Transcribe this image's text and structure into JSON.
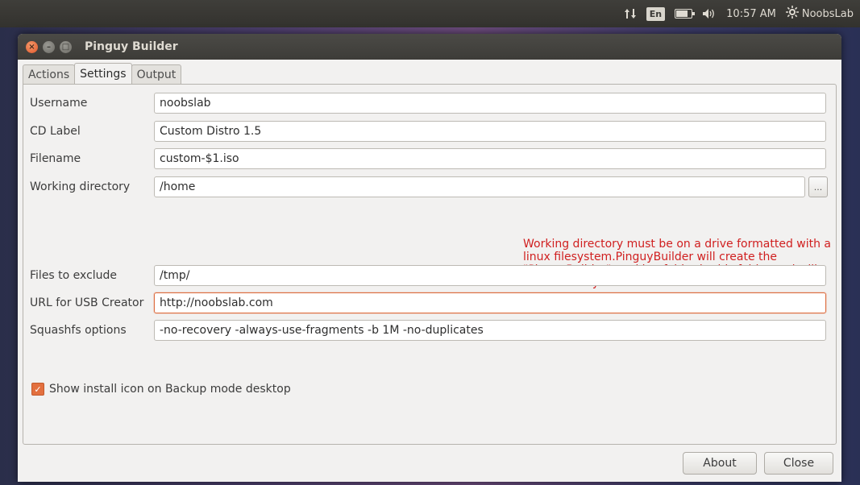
{
  "topbar": {
    "language": "En",
    "time": "10:57 AM",
    "user": "NoobsLab",
    "battery_level": 0.8
  },
  "window": {
    "title": "Pinguy Builder"
  },
  "tabs": [
    {
      "label": "Actions",
      "active": false
    },
    {
      "label": "Settings",
      "active": true
    },
    {
      "label": "Output",
      "active": false
    }
  ],
  "settings": {
    "username": {
      "label": "Username",
      "value": "noobslab"
    },
    "cd_label": {
      "label": "CD Label",
      "value": "Custom Distro 1.5"
    },
    "filename": {
      "label": "Filename",
      "value": "custom-$1.iso"
    },
    "working_dir": {
      "label": "Working directory",
      "value": "/home",
      "browse_label": "..."
    },
    "warning": "Working directory must be on a drive formatted with a linux filesystem.PinguyBuilder will create the \"PinguyBuilder\" working folder in this folder and will not harm any other files or folders.",
    "exclude": {
      "label": "Files to exclude",
      "value": "/tmp/"
    },
    "usb_url": {
      "label": "URL for USB Creator",
      "value": "http://noobslab.com"
    },
    "squashfs": {
      "label": "Squashfs options",
      "value": "-no-recovery -always-use-fragments -b 1M -no-duplicates"
    },
    "show_install_icon": {
      "label": "Show install icon on Backup mode desktop",
      "checked": true
    }
  },
  "buttons": {
    "about": "About",
    "close": "Close"
  },
  "colors": {
    "accent": "#dd6d3f",
    "warning_text": "#d01f1f",
    "titlebar": "#3d3c38"
  },
  "icons": {
    "network": "network-updown-icon",
    "battery": "battery-icon",
    "volume": "volume-icon",
    "session": "gear-icon"
  }
}
